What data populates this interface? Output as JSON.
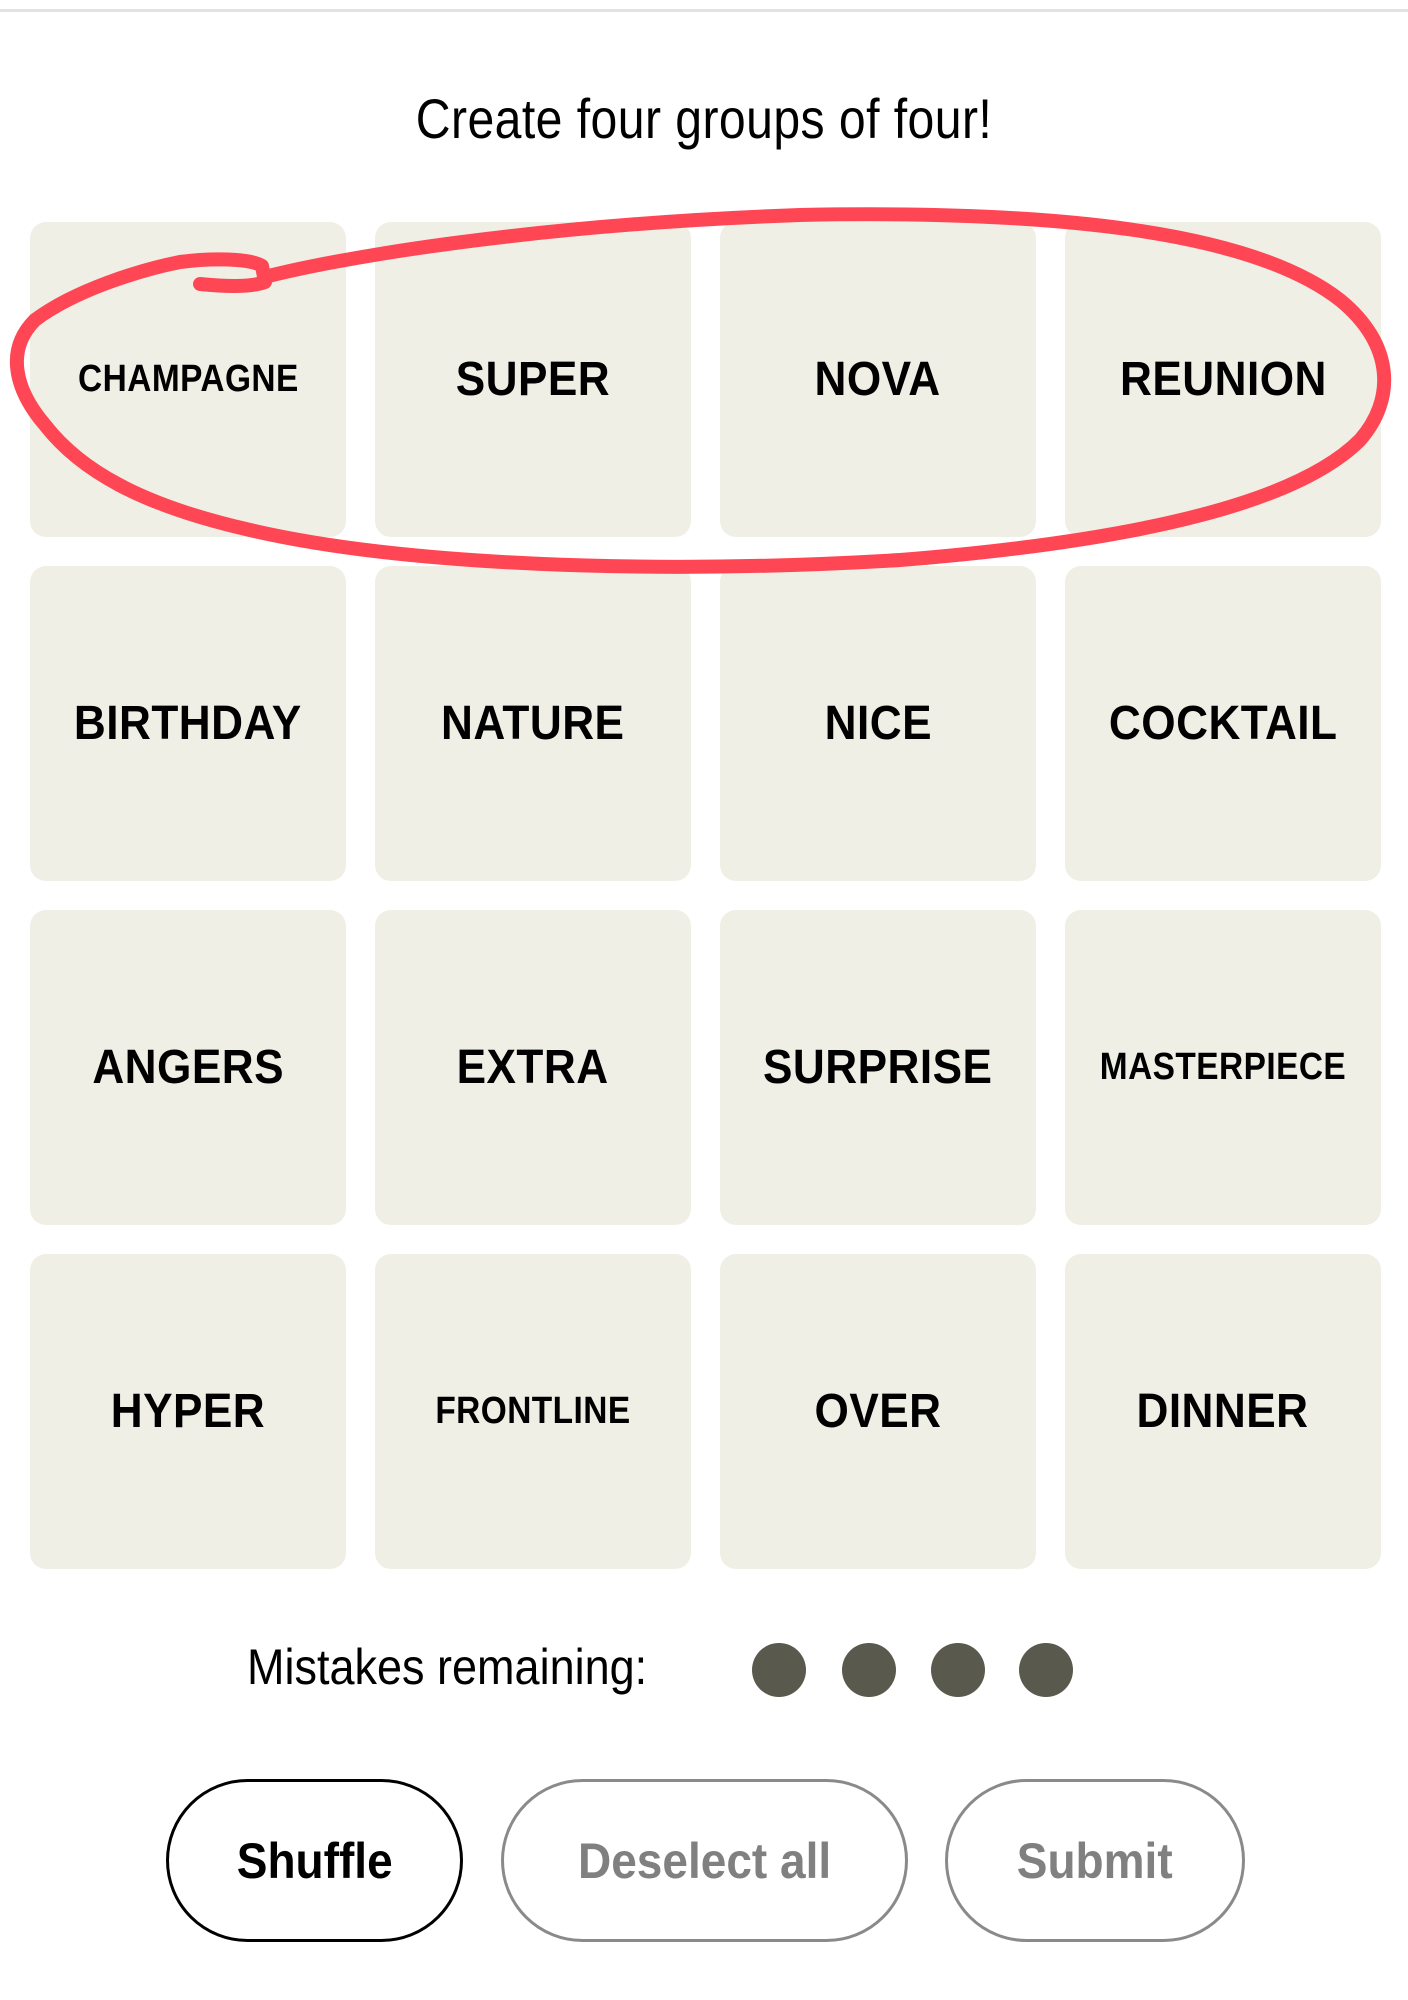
{
  "game": {
    "title": "Create four groups of four!",
    "tiles": [
      {
        "word": "CHAMPAGNE",
        "selected": false
      },
      {
        "word": "SUPER",
        "selected": false
      },
      {
        "word": "NOVA",
        "selected": false
      },
      {
        "word": "REUNION",
        "selected": false
      },
      {
        "word": "BIRTHDAY",
        "selected": false
      },
      {
        "word": "NATURE",
        "selected": false
      },
      {
        "word": "NICE",
        "selected": false
      },
      {
        "word": "COCKTAIL",
        "selected": false
      },
      {
        "word": "ANGERS",
        "selected": false
      },
      {
        "word": "EXTRA",
        "selected": false
      },
      {
        "word": "SURPRISE",
        "selected": false
      },
      {
        "word": "MASTERPIECE",
        "selected": false
      },
      {
        "word": "HYPER",
        "selected": false
      },
      {
        "word": "FRONTLINE",
        "selected": false
      },
      {
        "word": "OVER",
        "selected": false
      },
      {
        "word": "DINNER",
        "selected": false
      }
    ],
    "annotation": {
      "type": "hand-drawn circle",
      "circled_words": [
        "CHAMPAGNE",
        "SUPER",
        "NOVA",
        "REUNION"
      ],
      "color": "#ff4655"
    },
    "mistakes": {
      "label": "Mistakes remaining:",
      "remaining": 4,
      "dot_color": "#5a594e"
    },
    "buttons": {
      "shuffle": "Shuffle",
      "deselect_all": "Deselect all",
      "submit": "Submit"
    },
    "colors": {
      "tile_background": "#efefe6",
      "active_button_border": "#000000",
      "disabled_button": "#808080"
    }
  }
}
